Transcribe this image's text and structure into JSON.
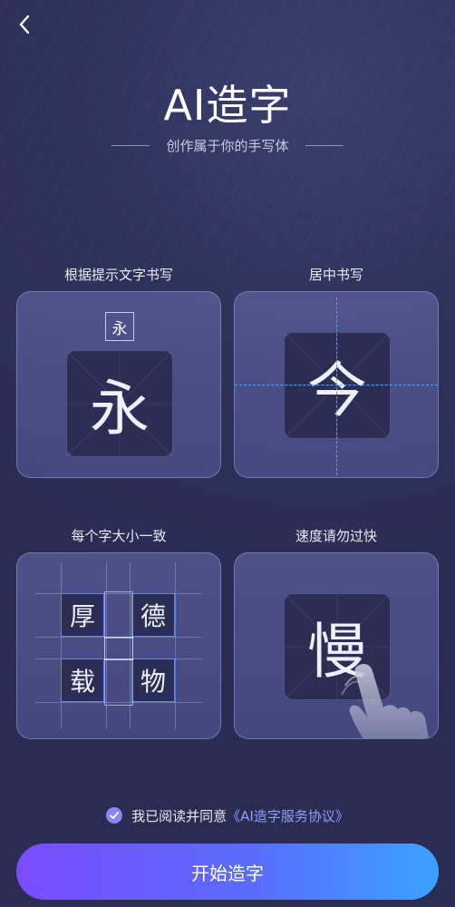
{
  "header": {
    "back_icon": "chevron-left-icon",
    "title": "AI造字",
    "subtitle": "创作属于你的手写体"
  },
  "tips": [
    {
      "label": "根据提示文字书写",
      "hint_char": "永",
      "char": "永"
    },
    {
      "label": "居中书写",
      "char": "今"
    },
    {
      "label": "每个字大小一致",
      "chars": [
        "厚",
        "德",
        "载",
        "物"
      ]
    },
    {
      "label": "速度请勿过快",
      "char": "慢"
    }
  ],
  "agreement": {
    "checked": true,
    "text": "我已阅读并同意",
    "link": "《AI造字服务协议》"
  },
  "start_button": {
    "label": "开始造字"
  },
  "colors": {
    "accent_purple": "#7a4cff",
    "accent_blue": "#3aa2ff",
    "guide_line": "#4da3ff",
    "link": "#8f9dff"
  }
}
